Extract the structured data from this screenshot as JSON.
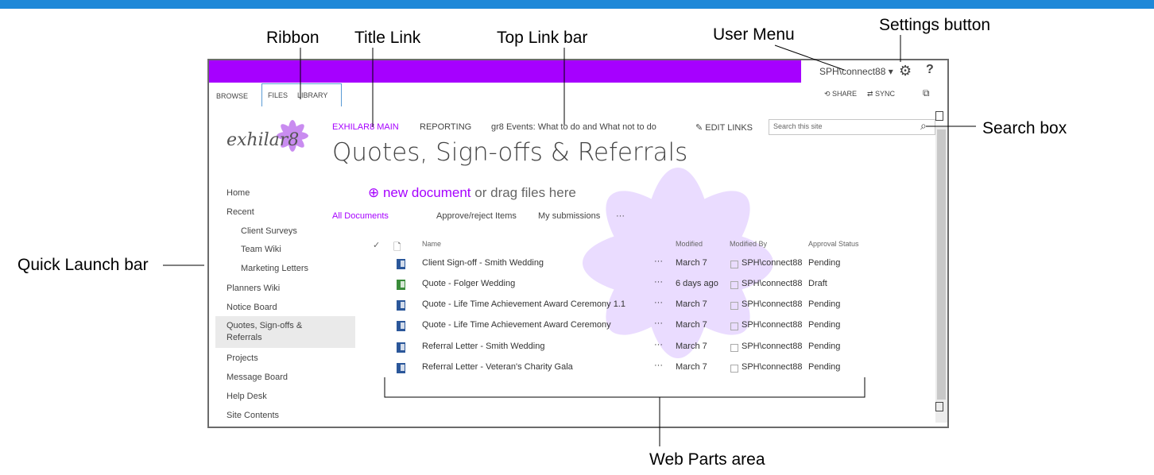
{
  "callouts": {
    "ribbon": "Ribbon",
    "title_link": "Title Link",
    "top_link_bar": "Top Link bar",
    "user_menu": "User Menu",
    "settings_button": "Settings button",
    "search_box": "Search box",
    "quick_launch": "Quick Launch bar",
    "web_parts": "Web Parts area"
  },
  "suitebar": {
    "user": "SPH\\connect88 ▾",
    "gear": "⚙",
    "help": "?"
  },
  "ribbon": {
    "tabs": [
      "BROWSE",
      "FILES",
      "LIBRARY"
    ],
    "share": "SHARE",
    "sync": "SYNC",
    "focus": "⧉"
  },
  "site": {
    "logo_text": "exhilar8",
    "title_link": "EXHILAR8 MAIN",
    "top_links": [
      "REPORTING",
      "gr8 Events: What to do and What not to do"
    ],
    "edit_links": "EDIT LINKS",
    "search_placeholder": "Search this site",
    "title": "Quotes, Sign-offs & Referrals"
  },
  "quick_launch": {
    "items": [
      "Home",
      "Recent",
      "Client Surveys",
      "Team Wiki",
      "Marketing Letters",
      "Planners Wiki",
      "Notice Board",
      "Quotes, Sign-offs &",
      "Referrals",
      "Projects",
      "Message Board",
      "Help Desk",
      "Site Contents"
    ]
  },
  "library": {
    "new_document": "new document",
    "new_document_rest": " or drag files here",
    "views": [
      "All Documents",
      "Approve/reject Items",
      "My submissions",
      "···"
    ],
    "columns": [
      "Name",
      "Modified",
      "Modified By",
      "Approval Status"
    ],
    "rows": [
      {
        "name": "Client Sign-off - Smith Wedding",
        "modified": "March 7",
        "by": "SPH\\connect88",
        "status": "Pending"
      },
      {
        "name": "Quote - Folger Wedding",
        "modified": "6 days ago",
        "by": "SPH\\connect88",
        "status": "Draft"
      },
      {
        "name": "Quote - Life Time Achievement Award Ceremony 1.1",
        "modified": "March 7",
        "by": "SPH\\connect88",
        "status": "Pending"
      },
      {
        "name": "Quote - Life Time Achievement Award Ceremony",
        "modified": "March 7",
        "by": "SPH\\connect88",
        "status": "Pending"
      },
      {
        "name": "Referral Letter - Smith Wedding",
        "modified": "March 7",
        "by": "SPH\\connect88",
        "status": "Pending"
      },
      {
        "name": "Referral Letter - Veteran's Charity Gala",
        "modified": "March 7",
        "by": "SPH\\connect88",
        "status": "Pending"
      }
    ],
    "ellipsis": "···",
    "checkmark": "✓"
  },
  "colors": {
    "suite_purple": "#a600ff",
    "top_strip": "#1e88d8"
  }
}
